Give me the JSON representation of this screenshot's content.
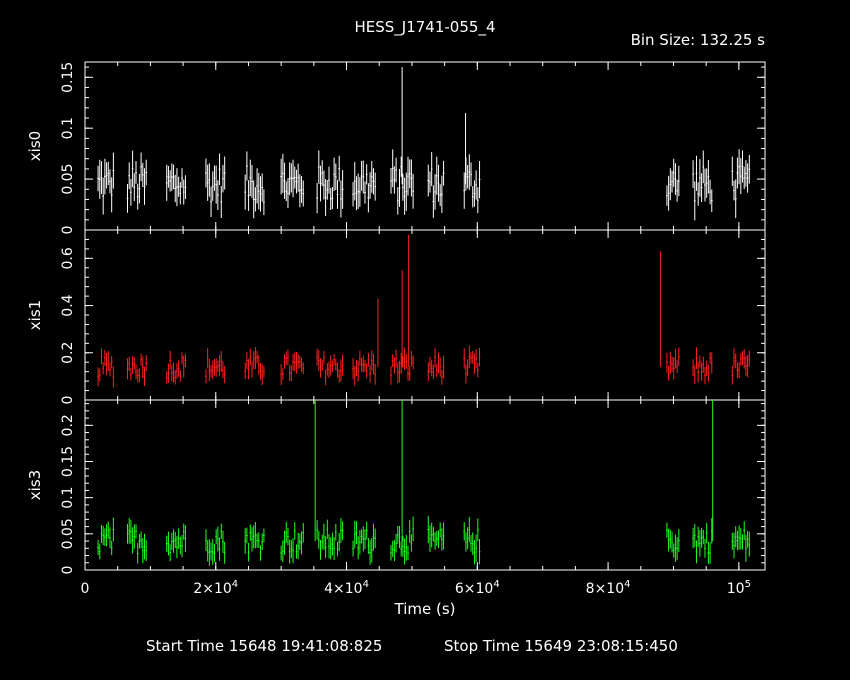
{
  "chart_data": {
    "type": "scatter",
    "title": "HESS_J1741-055_4",
    "bin_size_label": "Bin Size: 132.25 s",
    "xlabel": "Time (s)",
    "xlim": [
      0,
      104000
    ],
    "x_ticks": [
      {
        "value": 0,
        "label": "0",
        "exp": ""
      },
      {
        "value": 20000,
        "label": "2×10",
        "exp": "4"
      },
      {
        "value": 40000,
        "label": "4×10",
        "exp": "4"
      },
      {
        "value": 60000,
        "label": "6×10",
        "exp": "4"
      },
      {
        "value": 80000,
        "label": "8×10",
        "exp": "4"
      },
      {
        "value": 100000,
        "label": "10",
        "exp": "5"
      }
    ],
    "start_time": "Start Time 15648 19:41:08:825",
    "stop_time": "Stop Time 15649 23:08:15:450",
    "segments": [
      [
        2000,
        4500
      ],
      [
        6500,
        9500
      ],
      [
        12500,
        15500
      ],
      [
        18500,
        21500
      ],
      [
        24500,
        27500
      ],
      [
        30000,
        33500
      ],
      [
        35500,
        39500
      ],
      [
        41000,
        44500
      ],
      [
        46800,
        50200
      ],
      [
        52500,
        55000
      ],
      [
        58000,
        60500
      ],
      [
        89000,
        91000
      ],
      [
        93000,
        96000
      ],
      [
        99000,
        101800
      ]
    ],
    "series": [
      {
        "name": "xis0",
        "color": "#ffffff",
        "ylim": [
          0,
          0.165
        ],
        "yticks": [
          0,
          0.05,
          0.1,
          0.15
        ],
        "ytick_labels": [
          "0",
          "0.05",
          "0.1",
          "0.15"
        ],
        "base": 0.045,
        "spread": 0.018,
        "err": 0.016,
        "spikes": [
          {
            "x": 48500,
            "y": 0.16
          },
          {
            "x": 58200,
            "y": 0.115
          }
        ]
      },
      {
        "name": "xis1",
        "color": "#ff2020",
        "ylim": [
          0,
          0.72
        ],
        "yticks": [
          0,
          0.2,
          0.4,
          0.6
        ],
        "ytick_labels": [
          "0",
          "0.2",
          "0.4",
          "0.6"
        ],
        "base": 0.14,
        "spread": 0.045,
        "err": 0.04,
        "spikes": [
          {
            "x": 49500,
            "y": 0.7
          },
          {
            "x": 48500,
            "y": 0.55
          },
          {
            "x": 88000,
            "y": 0.63
          },
          {
            "x": 44800,
            "y": 0.43
          }
        ]
      },
      {
        "name": "xis3",
        "color": "#20ff20",
        "ylim": [
          0,
          0.235
        ],
        "yticks": [
          0,
          0.05,
          0.1,
          0.15,
          0.2
        ],
        "ytick_labels": [
          "0",
          "0.05",
          "0.1",
          "0.15",
          "0.2"
        ],
        "base": 0.04,
        "spread": 0.017,
        "err": 0.016,
        "spikes": [
          {
            "x": 35200,
            "y": 0.235
          },
          {
            "x": 48500,
            "y": 0.235
          },
          {
            "x": 96000,
            "y": 0.235
          }
        ]
      }
    ]
  }
}
